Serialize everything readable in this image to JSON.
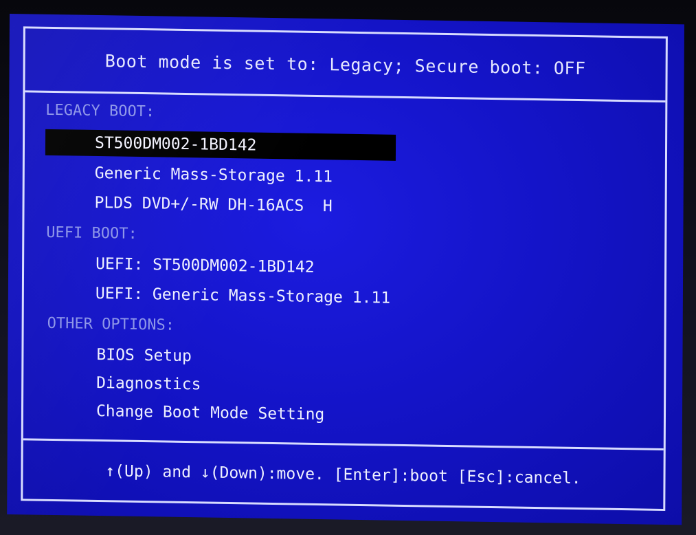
{
  "header": {
    "title": "Boot mode is set to: Legacy; Secure boot: OFF"
  },
  "sections": {
    "legacy": {
      "title": "LEGACY BOOT:",
      "items": [
        "ST500DM002-1BD142",
        "Generic Mass-Storage 1.11",
        "PLDS DVD+/-RW DH-16ACS  H"
      ]
    },
    "uefi": {
      "title": "UEFI BOOT:",
      "items": [
        "UEFI: ST500DM002-1BD142",
        "UEFI: Generic Mass-Storage 1.11"
      ]
    },
    "other": {
      "title": "OTHER OPTIONS:",
      "items": [
        "BIOS Setup",
        "Diagnostics",
        "Change Boot Mode Setting"
      ]
    }
  },
  "selected_item": "ST500DM002-1BD142",
  "footer": {
    "help": "↑(Up) and ↓(Down):move. [Enter]:boot [Esc]:cancel."
  },
  "colors": {
    "background": "#1414c8",
    "text": "#eef0ff",
    "section_title": "#8d95e8",
    "border": "#d8dcff",
    "highlight": "#000000"
  }
}
